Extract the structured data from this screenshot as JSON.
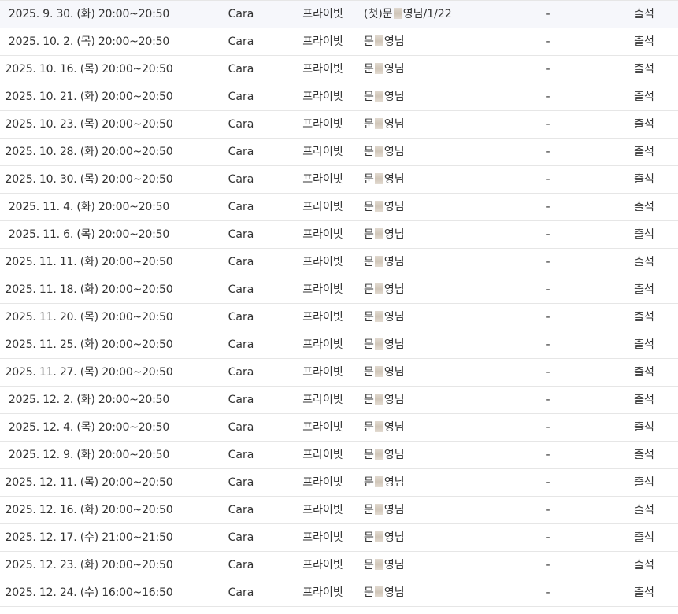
{
  "rows": [
    {
      "date": "2025. 9. 30. (화) 20:00~20:50",
      "teacher": "Cara",
      "type": "프라이빗",
      "name_pre": "(첫)문",
      "name_post": "영님/1/22",
      "memo": "-",
      "status": "출석"
    },
    {
      "date": "2025. 10. 2. (목) 20:00~20:50",
      "teacher": "Cara",
      "type": "프라이빗",
      "name_pre": "문",
      "name_post": "영님",
      "memo": "-",
      "status": "출석"
    },
    {
      "date": "2025. 10. 16. (목) 20:00~20:50",
      "teacher": "Cara",
      "type": "프라이빗",
      "name_pre": "문",
      "name_post": "영님",
      "memo": "-",
      "status": "출석"
    },
    {
      "date": "2025. 10. 21. (화) 20:00~20:50",
      "teacher": "Cara",
      "type": "프라이빗",
      "name_pre": "문",
      "name_post": "영님",
      "memo": "-",
      "status": "출석"
    },
    {
      "date": "2025. 10. 23. (목) 20:00~20:50",
      "teacher": "Cara",
      "type": "프라이빗",
      "name_pre": "문",
      "name_post": "영님",
      "memo": "-",
      "status": "출석"
    },
    {
      "date": "2025. 10. 28. (화) 20:00~20:50",
      "teacher": "Cara",
      "type": "프라이빗",
      "name_pre": "문",
      "name_post": "영님",
      "memo": "-",
      "status": "출석"
    },
    {
      "date": "2025. 10. 30. (목) 20:00~20:50",
      "teacher": "Cara",
      "type": "프라이빗",
      "name_pre": "문",
      "name_post": "영님",
      "memo": "-",
      "status": "출석"
    },
    {
      "date": "2025. 11. 4. (화) 20:00~20:50",
      "teacher": "Cara",
      "type": "프라이빗",
      "name_pre": "문",
      "name_post": "영님",
      "memo": "-",
      "status": "출석"
    },
    {
      "date": "2025. 11. 6. (목) 20:00~20:50",
      "teacher": "Cara",
      "type": "프라이빗",
      "name_pre": "문",
      "name_post": "영님",
      "memo": "-",
      "status": "출석"
    },
    {
      "date": "2025. 11. 11. (화) 20:00~20:50",
      "teacher": "Cara",
      "type": "프라이빗",
      "name_pre": "문",
      "name_post": "영님",
      "memo": "-",
      "status": "출석"
    },
    {
      "date": "2025. 11. 18. (화) 20:00~20:50",
      "teacher": "Cara",
      "type": "프라이빗",
      "name_pre": "문",
      "name_post": "영님",
      "memo": "-",
      "status": "출석"
    },
    {
      "date": "2025. 11. 20. (목) 20:00~20:50",
      "teacher": "Cara",
      "type": "프라이빗",
      "name_pre": "문",
      "name_post": "영님",
      "memo": "-",
      "status": "출석"
    },
    {
      "date": "2025. 11. 25. (화) 20:00~20:50",
      "teacher": "Cara",
      "type": "프라이빗",
      "name_pre": "문",
      "name_post": "영님",
      "memo": "-",
      "status": "출석"
    },
    {
      "date": "2025. 11. 27. (목) 20:00~20:50",
      "teacher": "Cara",
      "type": "프라이빗",
      "name_pre": "문",
      "name_post": "영님",
      "memo": "-",
      "status": "출석"
    },
    {
      "date": "2025. 12. 2. (화) 20:00~20:50",
      "teacher": "Cara",
      "type": "프라이빗",
      "name_pre": "문",
      "name_post": "영님",
      "memo": "-",
      "status": "출석"
    },
    {
      "date": "2025. 12. 4. (목) 20:00~20:50",
      "teacher": "Cara",
      "type": "프라이빗",
      "name_pre": "문",
      "name_post": "영님",
      "memo": "-",
      "status": "출석"
    },
    {
      "date": "2025. 12. 9. (화) 20:00~20:50",
      "teacher": "Cara",
      "type": "프라이빗",
      "name_pre": "문",
      "name_post": "영님",
      "memo": "-",
      "status": "출석"
    },
    {
      "date": "2025. 12. 11. (목) 20:00~20:50",
      "teacher": "Cara",
      "type": "프라이빗",
      "name_pre": "문",
      "name_post": "영님",
      "memo": "-",
      "status": "출석"
    },
    {
      "date": "2025. 12. 16. (화) 20:00~20:50",
      "teacher": "Cara",
      "type": "프라이빗",
      "name_pre": "문",
      "name_post": "영님",
      "memo": "-",
      "status": "출석"
    },
    {
      "date": "2025. 12. 17. (수) 21:00~21:50",
      "teacher": "Cara",
      "type": "프라이빗",
      "name_pre": "문",
      "name_post": "영님",
      "memo": "-",
      "status": "출석"
    },
    {
      "date": "2025. 12. 23. (화) 20:00~20:50",
      "teacher": "Cara",
      "type": "프라이빗",
      "name_pre": "문",
      "name_post": "영님",
      "memo": "-",
      "status": "출석"
    },
    {
      "date": "2025. 12. 24. (수) 16:00~16:50",
      "teacher": "Cara",
      "type": "프라이빗",
      "name_pre": "문",
      "name_post": "영님",
      "memo": "-",
      "status": "출석"
    }
  ],
  "colors": {
    "text": "#333333",
    "row_border": "#e6e6e6",
    "highlight_row_bg": "#f6f7fb"
  }
}
